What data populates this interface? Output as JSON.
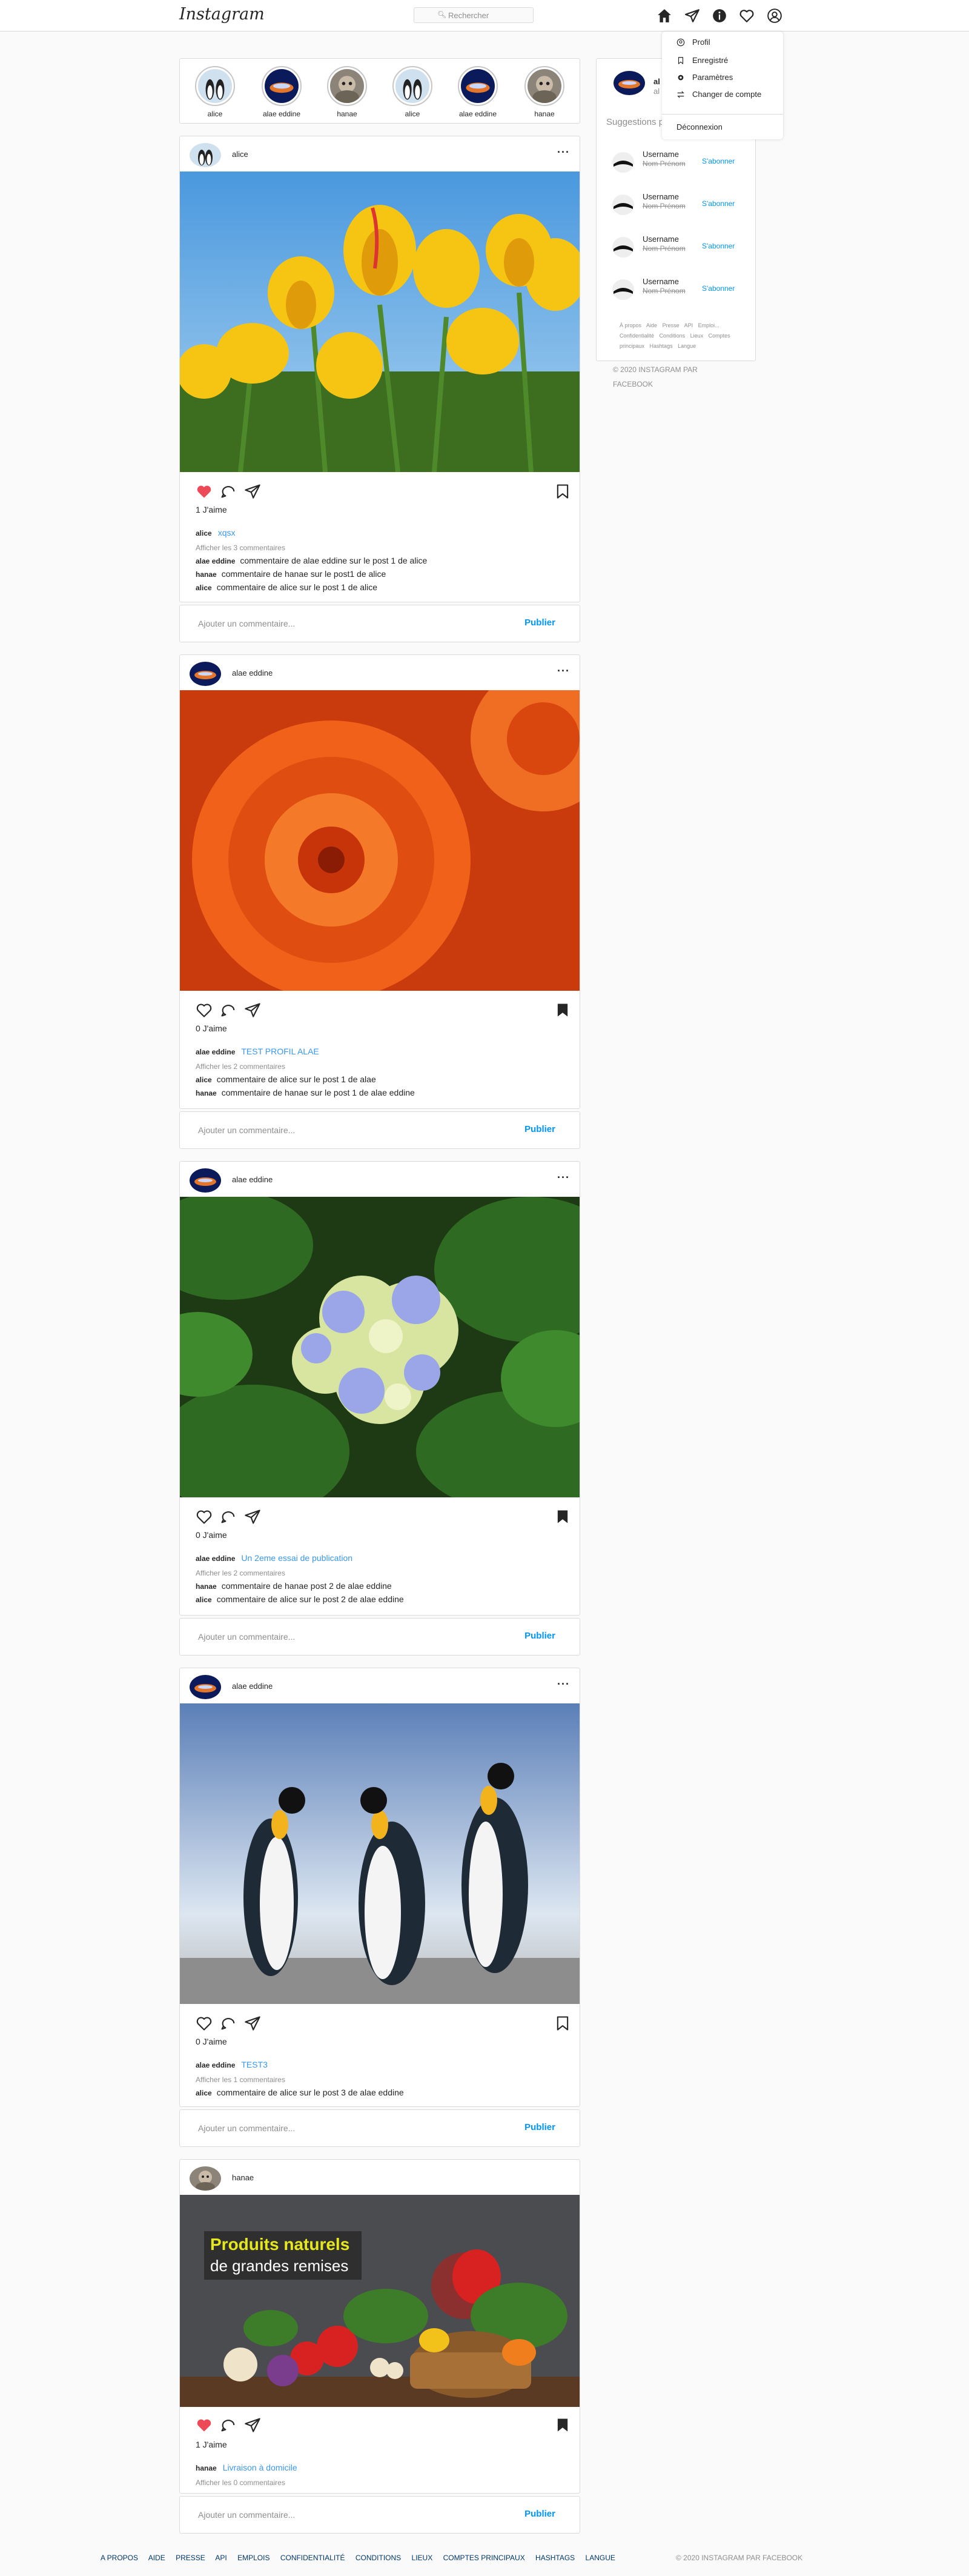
{
  "nav": {
    "logo": "Instagram",
    "search_placeholder": "Rechercher"
  },
  "dropdown": {
    "items": [
      "Profil",
      "Enregistré",
      "Paramètres",
      "Changer de compte"
    ],
    "logout": "Déconnexion"
  },
  "stories": [
    "alice",
    "alae eddine",
    "hanae",
    "alice",
    "alae eddine",
    "hanae"
  ],
  "posts": [
    {
      "user": "alice",
      "likes": "1 J'aime",
      "caption_user": "alice",
      "caption": "xqsx",
      "more": "Afficher les 3 commentaires",
      "comments": [
        {
          "user": "alae eddine",
          "text": "commentaire de alae eddine sur le post 1 de alice"
        },
        {
          "user": "hanae",
          "text": "commentaire de hanae sur le post1 de alice"
        },
        {
          "user": "alice",
          "text": "commentaire de alice sur le post 1 de alice"
        }
      ]
    },
    {
      "user": "alae eddine",
      "likes": "0 J'aime",
      "caption_user": "alae eddine",
      "caption": "TEST PROFIL ALAE",
      "more": "Afficher les 2 commentaires",
      "comments": [
        {
          "user": "alice",
          "text": "commentaire de alice sur le post 1 de alae"
        },
        {
          "user": "hanae",
          "text": "commentaire de hanae sur le post 1 de alae eddine"
        }
      ]
    },
    {
      "user": "alae eddine",
      "likes": "0 J'aime",
      "caption_user": "alae eddine",
      "caption": "Un 2eme essai de publication",
      "more": "Afficher les 2 commentaires",
      "comments": [
        {
          "user": "hanae",
          "text": "commentaire de hanae post 2 de alae eddine"
        },
        {
          "user": "alice",
          "text": "commentaire de alice sur le post 2 de alae eddine"
        }
      ]
    },
    {
      "user": "alae eddine",
      "likes": "0 J'aime",
      "caption_user": "alae eddine",
      "caption": "TEST3",
      "more": "Afficher les 1 commentaires",
      "comments": [
        {
          "user": "alice",
          "text": "commentaire de alice sur le post 3 de alae eddine"
        }
      ]
    },
    {
      "user": "hanae",
      "likes": "1 J'aime",
      "caption_user": "hanae",
      "caption": "Livraison à domicile",
      "more": "Afficher les 0 commentaires",
      "comments": [],
      "banner_line1": "Produits naturels",
      "banner_line2": "de grandes remises"
    }
  ],
  "add_comment_placeholder": "Ajouter un commentaire...",
  "publish": "Publier",
  "sidebar": {
    "me_name": "al",
    "me_sub": "al",
    "suggestions_title": "Suggestions p",
    "suggestions": [
      {
        "username": "Username",
        "name": "Nom Prénom",
        "follow": "S'abonner"
      },
      {
        "username": "Username",
        "name": "Nom Prénom",
        "follow": "S'abonner"
      },
      {
        "username": "Username",
        "name": "Nom Prénom",
        "follow": "S'abonner"
      },
      {
        "username": "Username",
        "name": "Nom Prénom",
        "follow": "S'abonner"
      }
    ],
    "links": [
      "À propos",
      "Aide",
      "Presse",
      "API",
      "Emploi...",
      "Confidentialité",
      "Conditions",
      "Lieux",
      "Comptes principaux",
      "Hashtags",
      "Langue"
    ],
    "copyright": "© 2020 INSTAGRAM PAR FACEBOOK"
  },
  "footer": {
    "links": [
      "A PROPOS",
      "AIDE",
      "PRESSE",
      "API",
      "EMPLOIS",
      "CONFIDENTIALITÉ",
      "CONDITIONS",
      "LIEUX",
      "COMPTES PRINCIPAUX",
      "HASHTAGS",
      "LANGUE"
    ],
    "copyright": "© 2020 INSTAGRAM PAR FACEBOOK"
  },
  "colors": {
    "like_red": "#ed4956",
    "link_blue": "#0095f6"
  }
}
